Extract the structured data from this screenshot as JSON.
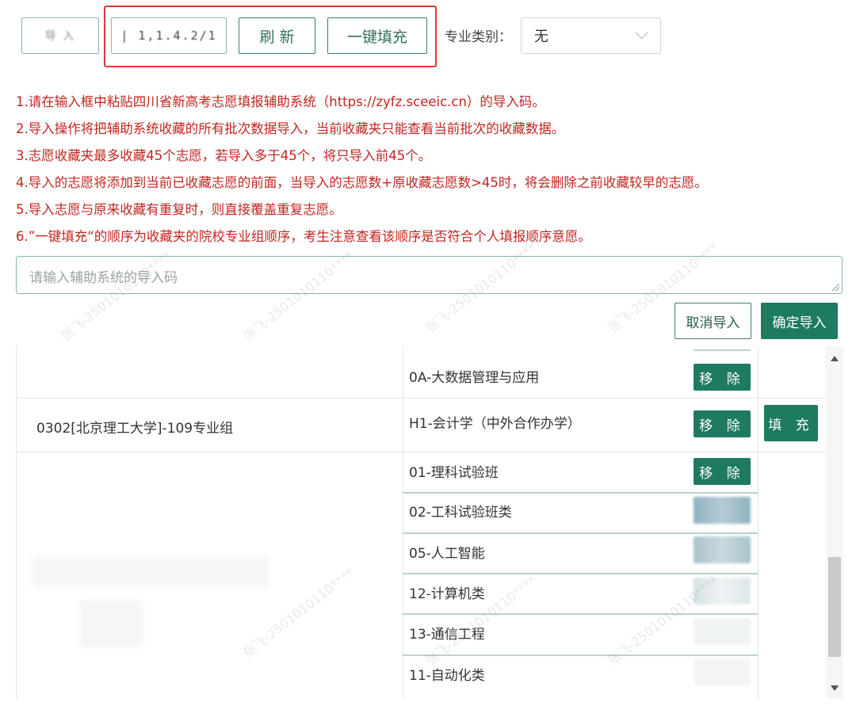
{
  "toolbar": {
    "blurred_button_label": "导 入",
    "import_code_value": "| 1,1.4.2/1",
    "refresh_label": "刷 新",
    "one_click_fill_label": "一键填充"
  },
  "category": {
    "label": "专业类别：",
    "selected": "无"
  },
  "notes": [
    "1.请在输入框中粘贴四川省新高考志愿填报辅助系统（https://zyfz.sceeic.cn）的导入码。",
    "2.导入操作将把辅助系统收藏的所有批次数据导入，当前收藏夹只能查看当前批次的收藏数据。",
    "3.志愿收藏夹最多收藏45个志愿，若导入多于45个，将只导入前45个。",
    "4.导入的志愿将添加到当前已收藏志愿的前面，当导入的志愿数+原收藏志愿数>45时，将会删除之前收藏较早的志愿。",
    "5.导入志愿与原来收藏有重复时，则直接覆盖重复志愿。",
    "6.”一键填充“的顺序为收藏夹的院校专业组顺序，考生注意查看该顺序是否符合个人填报顺序意愿。"
  ],
  "import": {
    "placeholder": "请输入辅助系统的导入码",
    "cancel_label": "取消导入",
    "confirm_label": "确定导入"
  },
  "table": {
    "group_name": "0302[北京理工大学]-109专业组",
    "remove_label": "移 除",
    "fill_label": "填 充",
    "majors": [
      "0A-大数据管理与应用",
      "H1-会计学（中外合作办学）",
      "01-理科试验班",
      "02-工科试验班类",
      "05-人工智能",
      "12-计算机类",
      "13-通信工程",
      "11-自动化类"
    ]
  },
  "watermark": "张飞-2501010110****",
  "colors": {
    "primary": "#1f7a62",
    "warning_red": "#c0251f",
    "highlight_frame": "#d93a37"
  }
}
